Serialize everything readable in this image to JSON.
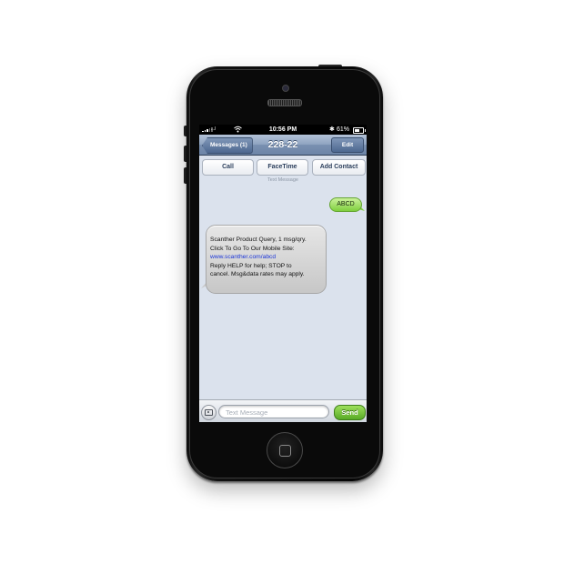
{
  "status_bar": {
    "carrier": "...l",
    "time": "10:56 PM",
    "battery": "61%",
    "battery_level": 0.61
  },
  "nav": {
    "back_label": "Messages (1)",
    "title": "228-22",
    "edit_label": "Edit"
  },
  "actions": {
    "call": "Call",
    "facetime": "FaceTime",
    "add_contact": "Add Contact"
  },
  "thread": {
    "label": "Text Message",
    "outgoing": "ABCD",
    "incoming": {
      "line1": "Scanther Product Query, 1 msg/qry.",
      "line2": "Click To Go To Our Mobile Site:",
      "link": "www.scanther.com/abcd",
      "line3": "Reply HELP for help; STOP to",
      "line4": "cancel. Msg&data rates may apply."
    }
  },
  "composer": {
    "placeholder": "Text Message",
    "send_label": "Send"
  },
  "colors": {
    "nav_blue": "#7a91b1",
    "outgoing_bubble": "#7fcf3e",
    "incoming_bubble": "#c8c8c8",
    "link": "#1a35d8",
    "screen_bg": "#dbe2ed"
  }
}
